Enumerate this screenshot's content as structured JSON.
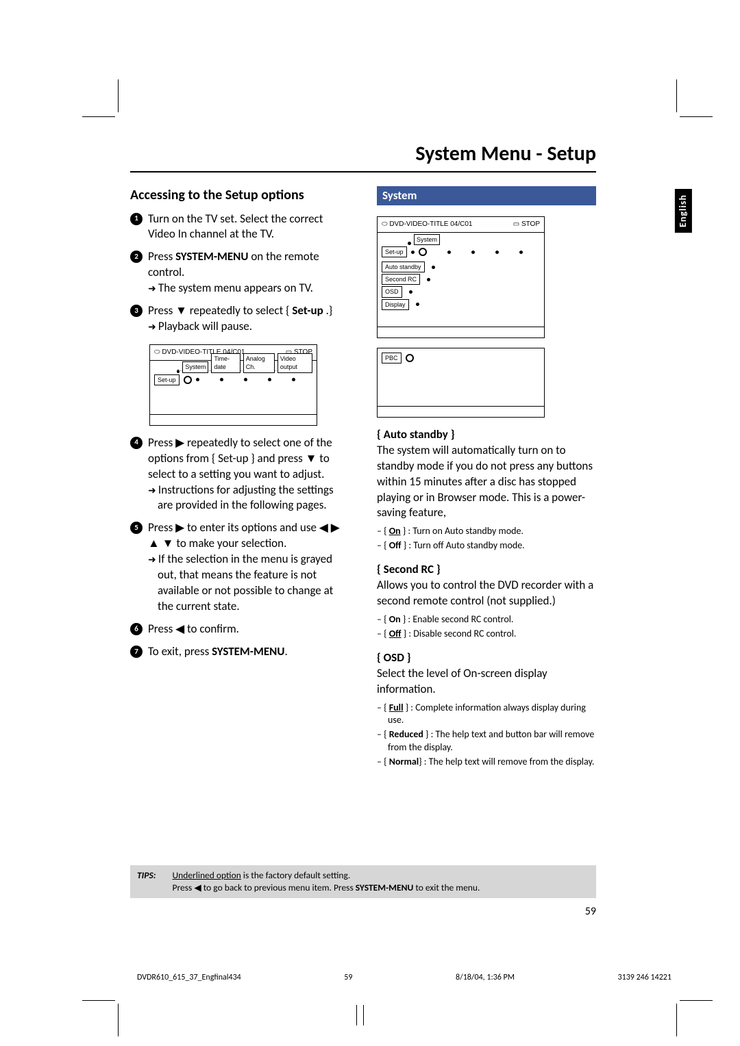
{
  "title": "System Menu - Setup",
  "side_tab": "English",
  "left": {
    "heading": "Accessing to the Setup options",
    "steps": {
      "s1": "Turn on the TV set.  Select the correct Video In channel at the TV.",
      "s2_a": "Press ",
      "s2_b": "SYSTEM-MENU",
      "s2_c": " on the remote control.",
      "s2_arrow": "The system menu appears on TV.",
      "s3_a": "Press ▼ repeatedly to select { ",
      "s3_b": "Set-up",
      "s3_c": " .}",
      "s3_arrow": "Playback will pause.",
      "s4": "Press ▶ repeatedly to select one of the options from { Set-up } and press ▼ to select to a setting you want to adjust.",
      "s4_arrow": "Instructions for adjusting the settings are provided in the following pages.",
      "s5": "Press ▶ to enter its options and use ◀ ▶ ▲ ▼ to make your selection.",
      "s5_arrow": "If the selection in the menu is grayed out, that means the feature is not available or not possible to change at the current state.",
      "s6": "Press ◀ to confirm.",
      "s7_a": "To exit, press ",
      "s7_b": "SYSTEM-MENU",
      "s7_c": "."
    },
    "menu1": {
      "header_left": "DVD-VIDEO-TITLE 04/C01",
      "header_right": "STOP",
      "tabs": [
        "System",
        "Time-date",
        "Analog Ch.",
        "Video output"
      ],
      "setup": "Set-up"
    }
  },
  "right": {
    "heading": "System",
    "menu2": {
      "header_left": "DVD-VIDEO-TITLE 04/C01",
      "header_right": "STOP",
      "tab": "System",
      "setup": "Set-up",
      "items": [
        "Auto standby",
        "Second RC",
        "OSD",
        "Display"
      ],
      "sub": "PBC"
    },
    "auto_standby": {
      "head": "{ Auto standby }",
      "body": "The system will automatically turn on to standby mode if you do not press any buttons within 15 minutes after a disc has stopped playing or in Browser mode. This is a power-saving feature,",
      "on_a": "{ ",
      "on_b": "On",
      "on_c": " } : Turn on Auto standby mode.",
      "off_a": "{ ",
      "off_b": "Off",
      "off_c": " } : Turn off Auto standby mode."
    },
    "second_rc": {
      "head": "{ Second RC }",
      "body": "Allows you to control the DVD recorder with a second remote control (not supplied.)",
      "on_a": "{ ",
      "on_b": "On",
      "on_c": " } : Enable second RC control.",
      "off_a": "{ ",
      "off_b": "Off",
      "off_c": " } : Disable second RC control."
    },
    "osd": {
      "head": "{ OSD }",
      "body": "Select the level of On-screen display information.",
      "full_a": "{ ",
      "full_b": "Full",
      "full_c": " } : Complete information always display during use.",
      "red_a": "{ ",
      "red_b": "Reduced",
      "red_c": " } : The help text and button bar will remove from the display.",
      "norm_a": "{ ",
      "norm_b": "Normal",
      "norm_c": "} : The help text will remove from the display."
    }
  },
  "tips": {
    "label": "TIPS:",
    "line1_a": "Underlined option",
    "line1_b": " is the factory default setting.",
    "line2_a": "Press ◀ to go back to previous menu item.  Press ",
    "line2_b": "SYSTEM-MENU",
    "line2_c": " to exit the menu."
  },
  "page_number": "59",
  "footer": {
    "left": "DVDR610_615_37_Engfinal434",
    "mid": "59",
    "date": "8/18/04, 1:36 PM",
    "right": "3139 246 14221"
  }
}
